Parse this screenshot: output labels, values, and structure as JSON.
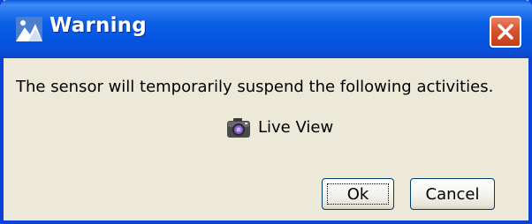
{
  "dialog": {
    "title": "Warning",
    "message": "The sensor will temporarily suspend the following activities.",
    "activities": [
      {
        "label": "Live View",
        "icon": "camera-icon"
      }
    ],
    "buttons": {
      "ok_label": "Ok",
      "cancel_label": "Cancel"
    },
    "title_icon": "warning-app-icon",
    "close_icon": "close-icon"
  },
  "colors": {
    "titlebar": "#0a5fe6",
    "window_border": "#0a43d8",
    "body_bg": "#ece9d8",
    "close_button": "#d8542e",
    "button_border": "#003c74"
  }
}
